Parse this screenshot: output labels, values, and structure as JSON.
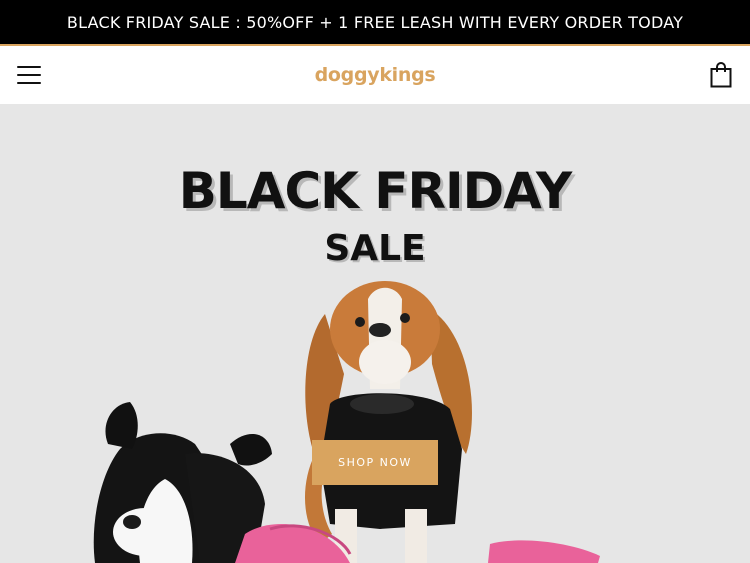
{
  "announcement": {
    "text": "BLACK FRIDAY SALE : 50%OFF + 1 FREE LEASH WITH EVERY ORDER TODAY"
  },
  "header": {
    "logo_text": "doggykings",
    "menu_icon": "hamburger-menu-icon",
    "cart_icon": "shopping-bag-icon"
  },
  "hero": {
    "title": "BLACK FRIDAY",
    "subtitle": "SALE",
    "cta_label": "SHOP NOW"
  },
  "colors": {
    "accent": "#d9a45f",
    "bar": "#000000",
    "hero_bg": "#e6e6e6",
    "coat_pink": "#e9629a"
  }
}
